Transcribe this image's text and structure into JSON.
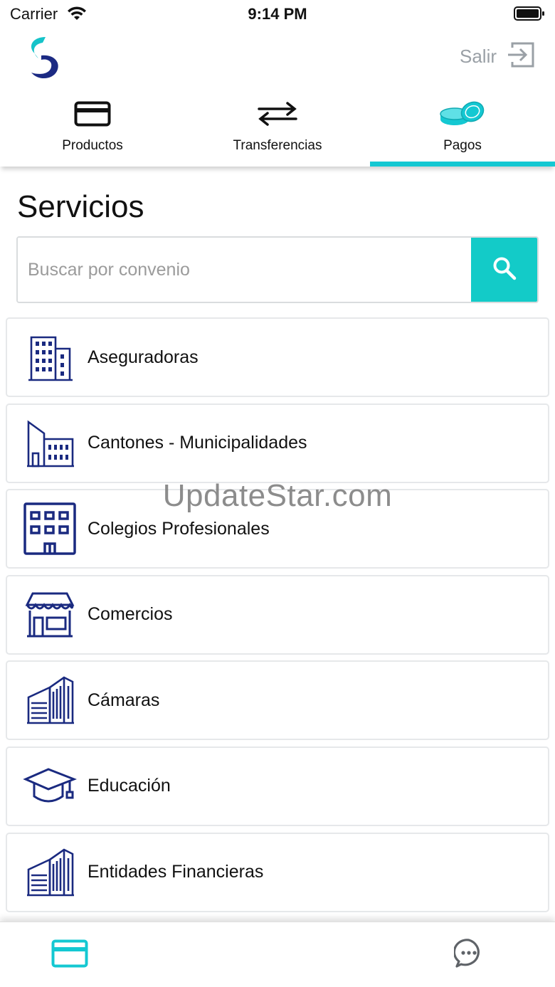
{
  "status_bar": {
    "carrier": "Carrier",
    "time": "9:14 PM"
  },
  "header": {
    "logout_label": "Salir"
  },
  "tabs": [
    {
      "label": "Productos",
      "icon": "credit-card-icon",
      "active": false
    },
    {
      "label": "Transferencias",
      "icon": "transfer-arrows-icon",
      "active": false
    },
    {
      "label": "Pagos",
      "icon": "coins-icon",
      "active": true
    }
  ],
  "page": {
    "title": "Servicios",
    "search_placeholder": "Buscar por convenio",
    "search_value": ""
  },
  "services": [
    {
      "label": "Aseguradoras",
      "icon": "office-building-icon"
    },
    {
      "label": "Cantones - Municipalidades",
      "icon": "municipal-building-icon"
    },
    {
      "label": "Colegios Profesionales",
      "icon": "college-building-icon"
    },
    {
      "label": "Comercios",
      "icon": "storefront-icon"
    },
    {
      "label": "Cámaras",
      "icon": "chamber-building-icon"
    },
    {
      "label": "Educación",
      "icon": "graduation-cap-icon"
    },
    {
      "label": "Entidades Financieras",
      "icon": "financial-building-icon"
    }
  ],
  "watermark": "UpdateStar.com",
  "colors": {
    "accent": "#14c8d2",
    "icon_navy": "#1a2a80",
    "logo_navy": "#1b2a83"
  }
}
